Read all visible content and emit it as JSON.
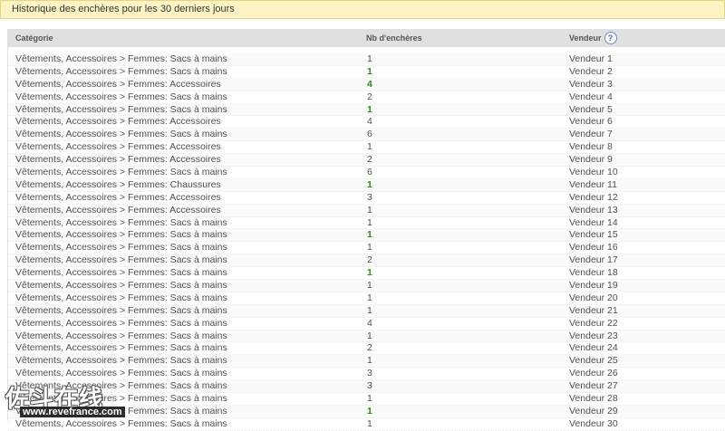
{
  "header": {
    "title": "Historique des enchères pour les 30 derniers jours"
  },
  "table": {
    "col_category": "Catégorie",
    "col_bids": "Nb d'enchères",
    "col_seller": "Vendeur",
    "help_symbol": "?",
    "rows": [
      {
        "category": "Vêtements, Accessoires > Femmes: Sacs à mains",
        "bids": "1",
        "seller": "Vendeur 1",
        "highlight": false
      },
      {
        "category": "Vêtements, Accessoires > Femmes: Sacs à mains",
        "bids": "1",
        "seller": "Vendeur 2",
        "highlight": true
      },
      {
        "category": "Vêtements, Accessoires > Femmes: Accessoires",
        "bids": "4",
        "seller": "Vendeur 3",
        "highlight": true
      },
      {
        "category": "Vêtements, Accessoires > Femmes: Sacs à mains",
        "bids": "2",
        "seller": "Vendeur 4",
        "highlight": false
      },
      {
        "category": "Vêtements, Accessoires > Femmes: Sacs à mains",
        "bids": "1",
        "seller": "Vendeur 5",
        "highlight": true
      },
      {
        "category": "Vêtements, Accessoires > Femmes: Accessoires",
        "bids": "4",
        "seller": "Vendeur 6",
        "highlight": false
      },
      {
        "category": "Vêtements, Accessoires > Femmes: Sacs à mains",
        "bids": "6",
        "seller": "Vendeur 7",
        "highlight": false
      },
      {
        "category": "Vêtements, Accessoires > Femmes: Accessoires",
        "bids": "1",
        "seller": "Vendeur 8",
        "highlight": false
      },
      {
        "category": "Vêtements, Accessoires > Femmes: Accessoires",
        "bids": "2",
        "seller": "Vendeur 9",
        "highlight": false
      },
      {
        "category": "Vêtements, Accessoires > Femmes: Sacs à mains",
        "bids": "6",
        "seller": "Vendeur 10",
        "highlight": false
      },
      {
        "category": "Vêtements, Accessoires > Femmes: Chaussures",
        "bids": "1",
        "seller": "Vendeur 11",
        "highlight": true
      },
      {
        "category": "Vêtements, Accessoires > Femmes: Accessoires",
        "bids": "3",
        "seller": "Vendeur 12",
        "highlight": false
      },
      {
        "category": "Vêtements, Accessoires > Femmes: Accessoires",
        "bids": "1",
        "seller": "Vendeur 13",
        "highlight": false
      },
      {
        "category": "Vêtements, Accessoires > Femmes: Sacs à mains",
        "bids": "1",
        "seller": "Vendeur 14",
        "highlight": false
      },
      {
        "category": "Vêtements, Accessoires > Femmes: Sacs à mains",
        "bids": "1",
        "seller": "Vendeur 15",
        "highlight": true
      },
      {
        "category": "Vêtements, Accessoires > Femmes: Sacs à mains",
        "bids": "1",
        "seller": "Vendeur 16",
        "highlight": false
      },
      {
        "category": "Vêtements, Accessoires > Femmes: Sacs à mains",
        "bids": "2",
        "seller": "Vendeur 17",
        "highlight": false
      },
      {
        "category": "Vêtements, Accessoires > Femmes: Sacs à mains",
        "bids": "1",
        "seller": "Vendeur 18",
        "highlight": true
      },
      {
        "category": "Vêtements, Accessoires > Femmes: Sacs à mains",
        "bids": "1",
        "seller": "Vendeur 19",
        "highlight": false
      },
      {
        "category": "Vêtements, Accessoires > Femmes: Sacs à mains",
        "bids": "1",
        "seller": "Vendeur 20",
        "highlight": false
      },
      {
        "category": "Vêtements, Accessoires > Femmes: Sacs à mains",
        "bids": "1",
        "seller": "Vendeur 21",
        "highlight": false
      },
      {
        "category": "Vêtements, Accessoires > Femmes: Sacs à mains",
        "bids": "4",
        "seller": "Vendeur 22",
        "highlight": false
      },
      {
        "category": "Vêtements, Accessoires > Femmes: Sacs à mains",
        "bids": "1",
        "seller": "Vendeur 23",
        "highlight": false
      },
      {
        "category": "Vêtements, Accessoires > Femmes: Sacs à mains",
        "bids": "2",
        "seller": "Vendeur 24",
        "highlight": false
      },
      {
        "category": "Vêtements, Accessoires > Femmes: Sacs à mains",
        "bids": "1",
        "seller": "Vendeur 25",
        "highlight": false
      },
      {
        "category": "Vêtements, Accessoires > Femmes: Sacs à mains",
        "bids": "3",
        "seller": "Vendeur 26",
        "highlight": false
      },
      {
        "category": "Vêtements, Accessoires > Femmes: Sacs à mains",
        "bids": "3",
        "seller": "Vendeur 27",
        "highlight": false
      },
      {
        "category": "Vêtements, Accessoires > Femmes: Sacs à mains",
        "bids": "1",
        "seller": "Vendeur 28",
        "highlight": false
      },
      {
        "category": "Vêtements, Accessoires > Femmes: Sacs à mains",
        "bids": "1",
        "seller": "Vendeur 29",
        "highlight": true
      },
      {
        "category": "Vêtements, Accessoires > Femmes: Sacs à mains",
        "bids": "1",
        "seller": "Vendeur 30",
        "highlight": false
      }
    ]
  },
  "watermark": {
    "main": "佐斗在线",
    "url": "www.revefrance.com"
  }
}
